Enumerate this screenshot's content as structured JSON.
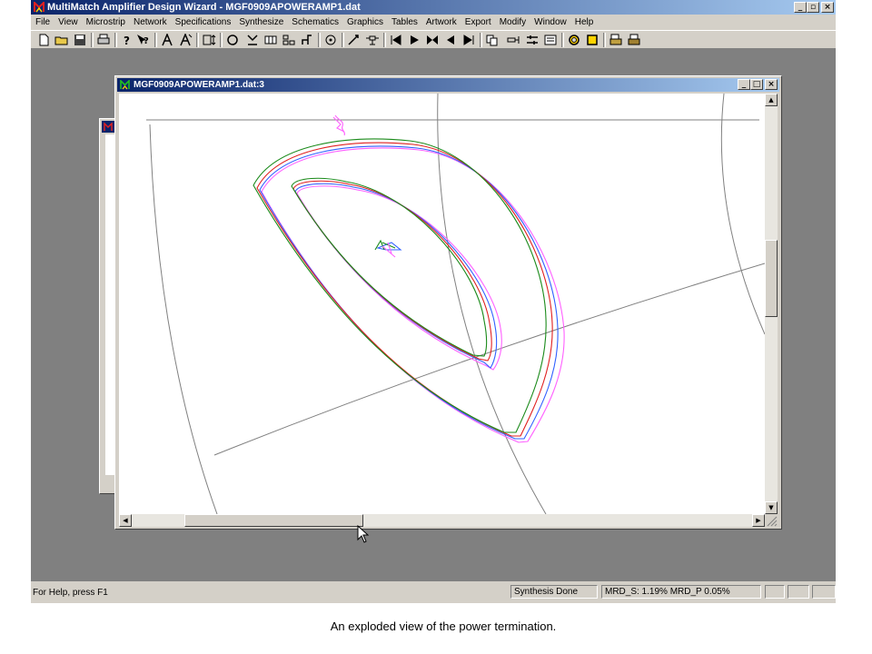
{
  "app": {
    "title": "MultiMatch Amplifier Design Wizard - MGF0909APOWERAMP1.dat",
    "minimize": "_",
    "restore": "▫",
    "close": "×"
  },
  "menu": [
    "File",
    "View",
    "Microstrip",
    "Network",
    "Specifications",
    "Synthesize",
    "Schematics",
    "Graphics",
    "Tables",
    "Artwork",
    "Export",
    "Modify",
    "Window",
    "Help"
  ],
  "toolbar": {
    "icons": [
      "new-file-icon",
      "open-folder-icon",
      "save-icon",
      "print-icon",
      "help-icon",
      "context-help-icon",
      "amplifier-a-icon",
      "amplifier-a2-icon",
      "frame-icon",
      "circle-icon",
      "marker-icon",
      "box-icon",
      "network-icon",
      "branch-icon",
      "target-icon",
      "tune-icon",
      "component-icon",
      "first-icon",
      "play-icon",
      "bowtie-icon",
      "back-icon",
      "last-icon",
      "copy-icon",
      "probe-icon",
      "settings-icon",
      "list-icon",
      "ring-icon",
      "square-icon",
      "stack-icon",
      "print-stack-icon"
    ]
  },
  "child_window": {
    "title": "MGF0909APOWERAMP1.dat:3",
    "minimize": "_",
    "restore": "□",
    "close": "×"
  },
  "scrollbars": {
    "up": "▲",
    "down": "▼",
    "left": "◀",
    "right": "▶",
    "vertical_position": 0.42,
    "horizontal_position": 0.12
  },
  "chart_colors": {
    "green": "#1a8a1a",
    "red": "#e02020",
    "blue": "#3060ff",
    "magenta": "#ff60ff",
    "grid": "#808080"
  },
  "status": {
    "help_text": "For Help, press F1",
    "synthesis": "Synthesis Done",
    "mrd": "MRD_S:  1.19% MRD_P  0.05%"
  },
  "caption": "An exploded view of the power termination."
}
